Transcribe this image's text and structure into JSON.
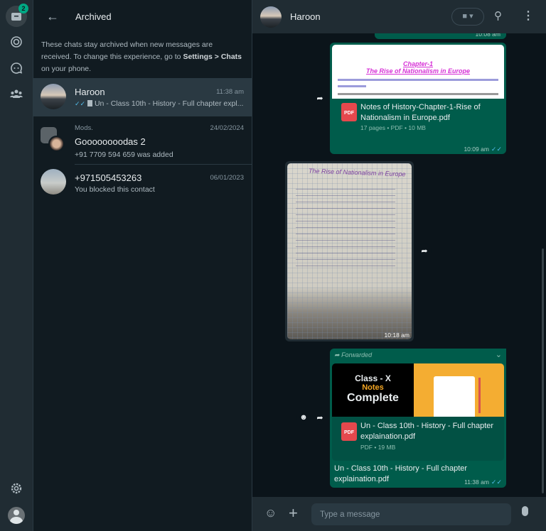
{
  "rail": {
    "archived_badge": "2"
  },
  "list": {
    "title": "Archived",
    "info_a": "These chats stay archived when new messages are received. To change this experience, go to ",
    "info_b": "Settings > Chats",
    "info_c": " on your phone.",
    "chats": [
      {
        "name": "Haroon",
        "time": "11:38 am",
        "preview": "Un - Class 10th - History - Full chapter expl..."
      },
      {
        "group": "Mods.",
        "name": "Goooooooodas 2",
        "time": "24/02/2024",
        "preview": "+91 7709 594 659 was added"
      },
      {
        "name": "+971505453263",
        "time": "06/01/2023",
        "preview": "You blocked this contact"
      }
    ]
  },
  "header": {
    "contact": "Haroon"
  },
  "messages": {
    "m0": {
      "time": "10:08 am"
    },
    "m1": {
      "preview_title": "Chapter-1",
      "preview_subtitle": "The Rise of Nationalism in Europe",
      "file": "Notes of History-Chapter-1-Rise of Nationalism in Europe.pdf",
      "meta": "17 pages • PDF • 10 MB",
      "time": "10:09 am",
      "icon": "PDF"
    },
    "m2": {
      "time": "10:18 am",
      "image_heading": "The Rise of Nationalism in Europe"
    },
    "m3": {
      "forwarded": "Forwarded",
      "thumb_l1": "Class - X",
      "thumb_l2": "Notes",
      "thumb_l3": "Complete",
      "file": "Un - Class 10th - History - Full chapter explaination.pdf",
      "meta": "PDF • 19 MB",
      "caption": "Un - Class 10th - History - Full chapter explaination.pdf",
      "time": "11:38 am",
      "icon": "PDF"
    }
  },
  "composer": {
    "placeholder": "Type a message"
  }
}
